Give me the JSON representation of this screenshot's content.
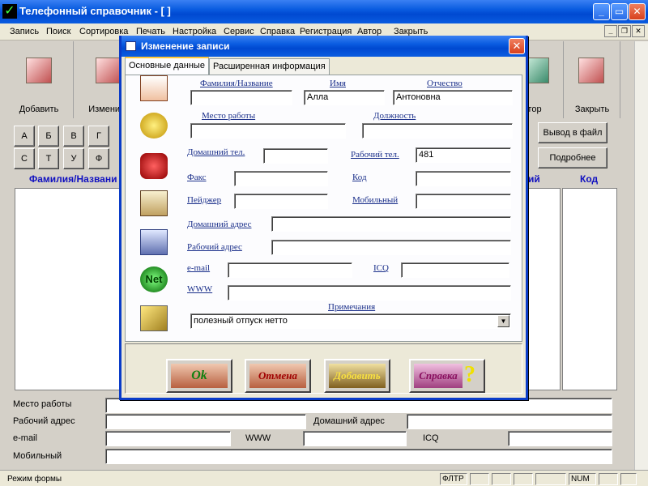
{
  "window": {
    "title": "Телефонный справочник - [ ]"
  },
  "menu": [
    "Запись",
    "Поиск",
    "Сортировка",
    "Печать",
    "Настройка",
    "Сервис",
    "Справка",
    "Регистрация",
    "Автор",
    "Закрыть"
  ],
  "toolbar": {
    "add": "Добавить",
    "edit": "Изменить",
    "author": "тор",
    "close": "Закрыть"
  },
  "letters_row1": [
    "А",
    "Б",
    "В",
    "Г"
  ],
  "letters_row2": [
    "С",
    "Т",
    "У",
    "Ф"
  ],
  "buttons": {
    "export": "Вывод в файл",
    "details": "Подробнее"
  },
  "grid": {
    "col_name": "Фамилия/Названи",
    "col_right": "ий",
    "col_code": "Код"
  },
  "bottom": {
    "work_place": "Место работы",
    "work_address": "Рабочий адрес",
    "home_address": "Домашний адрес",
    "email": "e-mail",
    "www": "WWW",
    "icq": "ICQ",
    "mobile": "Мобильный"
  },
  "status": {
    "mode": "Режим формы",
    "filter": "ФЛТР",
    "num": "NUM"
  },
  "dialog": {
    "title": "Изменение записи",
    "tabs": [
      "Основные данные",
      "Расширенная информация"
    ],
    "labels": {
      "surname": "Фамилия/Название",
      "name": "Имя",
      "patronymic": "Отчество",
      "work_place": "Место работы",
      "position": "Должность",
      "home_phone": "Домашний тел.",
      "work_phone": "Рабочий тел.",
      "fax": "Факс",
      "code": "Код",
      "pager": "Пейджер",
      "mobile": "Мобильный",
      "home_address": "Домашний адрес",
      "work_address": "Рабочий адрес",
      "email": "e-mail",
      "icq": "ICQ",
      "www": "WWW",
      "notes": "Примечания"
    },
    "values": {
      "surname": "",
      "name": "Алла",
      "patronymic": "Антоновна",
      "work_phone": "481",
      "notes": "полезный отпуск нетто"
    },
    "buttons": {
      "ok": "Ok",
      "cancel": "Отмена",
      "add": "Добавить",
      "help": "Справка"
    }
  },
  "colors": {
    "titlebar": "#0a5ce0",
    "link": "#1a2f8a",
    "grid_header": "#1010c0"
  }
}
